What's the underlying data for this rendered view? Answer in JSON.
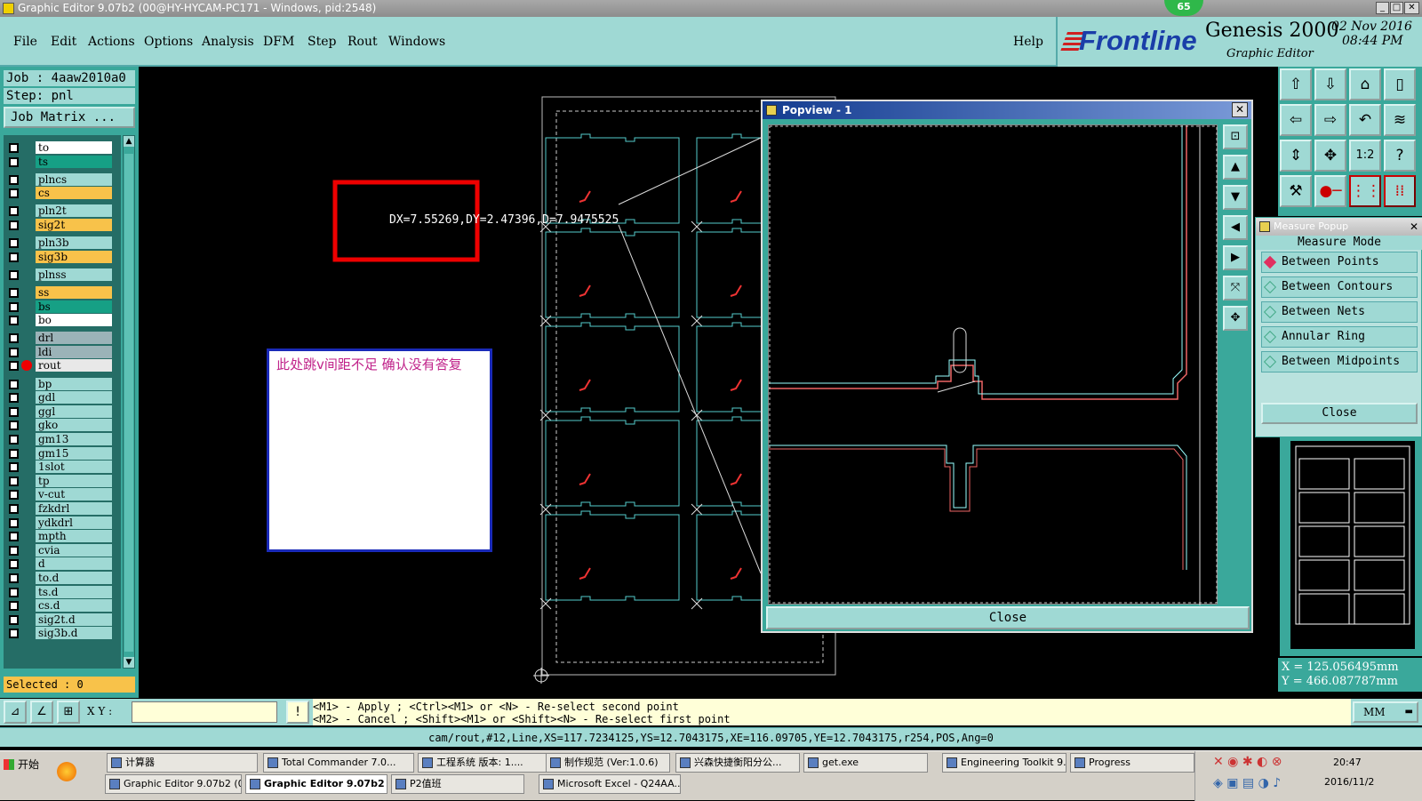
{
  "window": {
    "title": "Graphic Editor 9.07b2 (00@HY-HYCAM-PC171 - Windows, pid:2548)",
    "badge": "65"
  },
  "menu": [
    "File",
    "Edit",
    "Actions",
    "Options",
    "Analysis",
    "DFM",
    "Step",
    "Rout",
    "Windows"
  ],
  "help": "Help",
  "brand": {
    "logo": "Frontline",
    "product": "Genesis 2000",
    "subtitle": "Graphic Editor",
    "date": "02 Nov 2016",
    "time": "08:44 PM"
  },
  "job": {
    "job_line": "Job : 4aaw2010a0",
    "step_line": "Step: pnl",
    "matrix_button": "Job Matrix ..."
  },
  "layers": [
    {
      "name": "to",
      "color": "#ffffff"
    },
    {
      "name": "ts",
      "color": "#16a085"
    },
    {
      "name": "plncs",
      "color": "#9fd9d4"
    },
    {
      "name": "cs",
      "color": "#f8c24a"
    },
    {
      "name": "pln2t",
      "color": "#9fd9d4"
    },
    {
      "name": "sig2t",
      "color": "#f8c24a"
    },
    {
      "name": "pln3b",
      "color": "#9fd9d4"
    },
    {
      "name": "sig3b",
      "color": "#f8c24a"
    },
    {
      "name": "plnss",
      "color": "#9fd9d4"
    },
    {
      "name": "ss",
      "color": "#f8c24a"
    },
    {
      "name": "bs",
      "color": "#16a085"
    },
    {
      "name": "bo",
      "color": "#ffffff"
    },
    {
      "name": "drl",
      "color": "#9bb3b8"
    },
    {
      "name": "ldi",
      "color": "#9bb3b8"
    },
    {
      "name": "rout",
      "color": "#e8e8e8"
    },
    {
      "name": "bp",
      "color": "#9fd9d4"
    },
    {
      "name": "gdl",
      "color": "#9fd9d4"
    },
    {
      "name": "ggl",
      "color": "#9fd9d4"
    },
    {
      "name": "gko",
      "color": "#9fd9d4"
    },
    {
      "name": "gm13",
      "color": "#9fd9d4"
    },
    {
      "name": "gm15",
      "color": "#9fd9d4"
    },
    {
      "name": "1slot",
      "color": "#9fd9d4"
    },
    {
      "name": "tp",
      "color": "#9fd9d4"
    },
    {
      "name": "v-cut",
      "color": "#9fd9d4"
    },
    {
      "name": "fzkdrl",
      "color": "#9fd9d4"
    },
    {
      "name": "ydkdrl",
      "color": "#9fd9d4"
    },
    {
      "name": "mpth",
      "color": "#9fd9d4"
    },
    {
      "name": "cvia",
      "color": "#9fd9d4"
    },
    {
      "name": "d",
      "color": "#9fd9d4"
    },
    {
      "name": "to.d",
      "color": "#9fd9d4"
    },
    {
      "name": "ts.d",
      "color": "#9fd9d4"
    },
    {
      "name": "cs.d",
      "color": "#9fd9d4"
    },
    {
      "name": "sig2t.d",
      "color": "#9fd9d4"
    },
    {
      "name": "sig3b.d",
      "color": "#9fd9d4"
    }
  ],
  "selected": "Selected : 0",
  "measure_text": "DX=7.55269,DY=2.47396,D=7.9475525",
  "note": "此处跳v间距不足   确认没有答复",
  "popview": {
    "title": "Popview - 1",
    "close": "Close"
  },
  "measure_popup": {
    "title": "Measure Popup",
    "mode": "Measure Mode",
    "options": [
      "Between Points",
      "Between Contours",
      "Between Nets",
      "Annular Ring",
      "Between Midpoints"
    ],
    "close": "Close"
  },
  "coords": {
    "x": "X = 125.056495mm",
    "y": "Y = 466.087787mm"
  },
  "units": "MM",
  "xy_label": "X Y :",
  "hints": [
    "<M1> - Apply  ; <Ctrl><M1> or <N> - Re-select second point",
    "<M2> - Cancel ; <Shift><M1> or <Shift><N> - Re-select first point"
  ],
  "status": "cam/rout,#12,Line,XS=117.7234125,YS=12.7043175,XE=116.09705,YE=12.7043175,r254,POS,Ang=0",
  "taskbar": {
    "start": "开始",
    "row1": [
      "计算器",
      "Total Commander 7.0...",
      "工程系统  版本: 1....",
      "制作规范 (Ver:1.0.6)",
      "兴森快捷衡阳分公...",
      "get.exe",
      "Engineering Toolkit 9....",
      "Progress"
    ],
    "row2": [
      "Graphic Editor 9.07b2 (0...",
      "Graphic Editor 9.07b2 ...",
      "P2值班",
      "Microsoft Excel - Q24AA..."
    ],
    "clock_time": "20:47",
    "clock_date": "2016/11/2"
  }
}
